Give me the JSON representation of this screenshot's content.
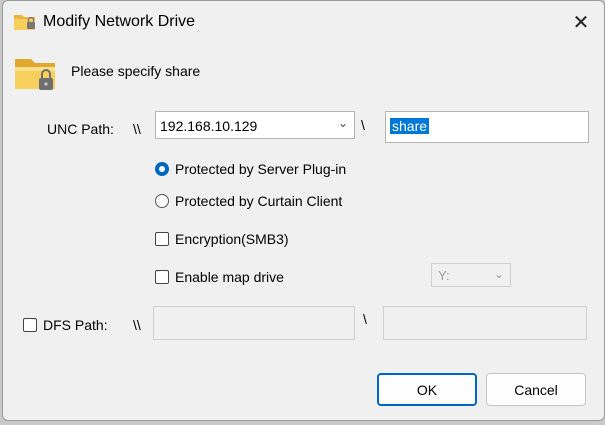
{
  "window": {
    "title": "Modify Network Drive",
    "close_glyph": "✕"
  },
  "header": {
    "prompt": "Please specify share"
  },
  "unc": {
    "label": "UNC Path:",
    "prefix": "\\\\",
    "server": "192.168.10.129",
    "separator": "\\",
    "share": "share"
  },
  "options": {
    "protected_plugin": "Protected by Server Plug-in",
    "protected_client": "Protected by Curtain Client",
    "encryption": "Encryption(SMB3)",
    "map_drive": "Enable map drive",
    "drive_letter": "Y:"
  },
  "dfs": {
    "label": "DFS Path:",
    "prefix": "\\\\",
    "separator": "\\"
  },
  "buttons": {
    "ok": "OK",
    "cancel": "Cancel"
  },
  "colors": {
    "accent": "#0067c0",
    "selection": "#0078d7",
    "folder": "#f2c04a"
  },
  "icons": {
    "title": "folder-lock-icon",
    "header": "folder-lock-icon",
    "chevron": "chevron-down-icon"
  }
}
